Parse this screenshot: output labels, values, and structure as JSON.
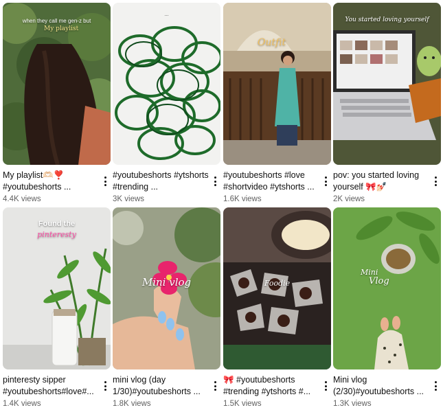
{
  "videos": [
    {
      "title": "My playlist🫶🏻❣️ #youtubeshorts ...",
      "views": "4.4K views",
      "overlay": "when they call me gen-z but",
      "overlay2": "My playlist"
    },
    {
      "title": "#youtubeshorts #ytshorts #trending ...",
      "views": "3K views",
      "overlay": "...",
      "overlay2": ""
    },
    {
      "title": "#youtubeshorts #love #shortvideo #ytshorts ...",
      "views": "1.6K views",
      "overlay": "Outfit",
      "overlay2": ""
    },
    {
      "title": "pov: you started loving yourself 🎀💅🏻",
      "views": "2K views",
      "overlay": "You started loving yourself",
      "overlay2": ""
    },
    {
      "title": "pinteresty sipper #youtubeshorts#love#...",
      "views": "1.4K views",
      "overlay": "Found the",
      "overlay2": "pinteresty"
    },
    {
      "title": "mini vlog (day 1/30)#youtubeshorts ...",
      "views": "1.8K views",
      "overlay": "Mini vlog",
      "overlay2": ""
    },
    {
      "title": "🎀 #youtubeshorts #trending #ytshorts #...",
      "views": "1.5K views",
      "overlay": "Foodie",
      "overlay2": ""
    },
    {
      "title": "Mini vlog (2/30)#youtubeshorts ...",
      "views": "1.3K views",
      "overlay": "Mini",
      "overlay2": "Vlog"
    }
  ],
  "icons": {
    "more": "more-vert-icon"
  }
}
